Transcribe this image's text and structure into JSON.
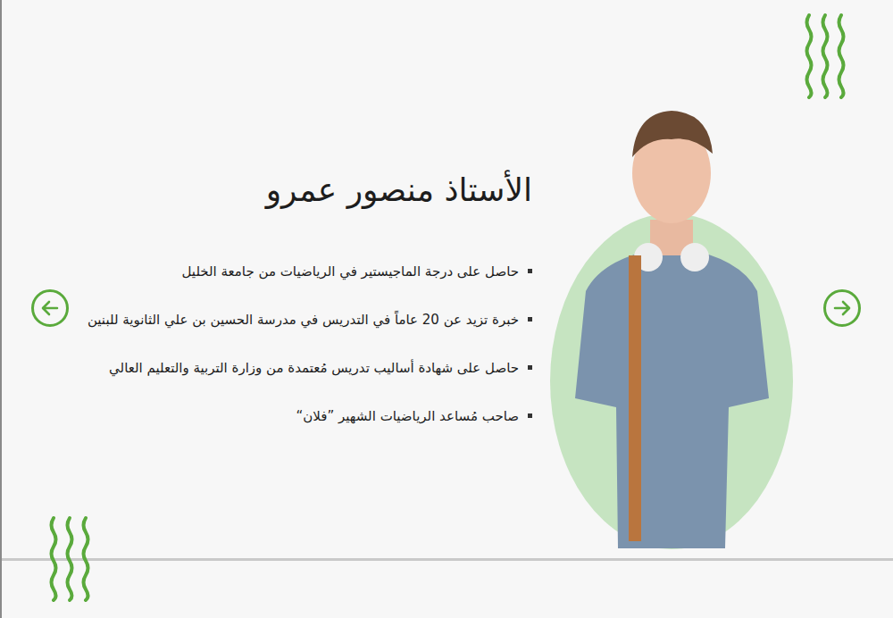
{
  "teacher": {
    "name": "الأستاذ منصور عمرو",
    "qualifications": [
      "حاصل على درجة الماجيستير في الرياضيات من جامعة الخليل",
      "خبرة تزيد عن 20 عاماً في التدريس في مدرسة الحسين بن علي الثانوية للبنين",
      "حاصل على شهادة أساليب تدريس مُعتمدة من وزارة التربية والتعليم العالي",
      "صاحب مُساعد الرياضيات الشهير ”فلان“"
    ]
  }
}
